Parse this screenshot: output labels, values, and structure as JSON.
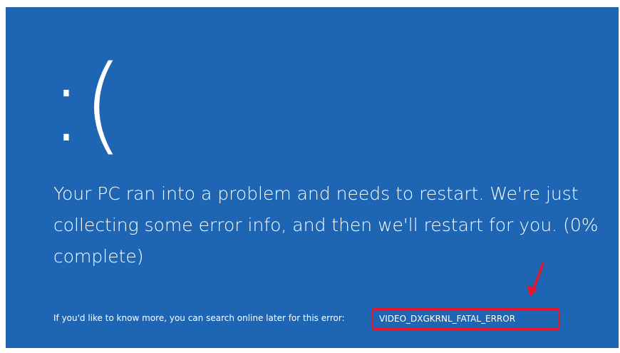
{
  "screen": {
    "background_color": "#1e66b4",
    "text_color": "#ffffff",
    "highlight_color": "#e5152b",
    "sad_face": ":(",
    "message": "Your PC ran into a problem and needs to restart. We're just collecting some error info, and then we'll restart for you. (0% complete)",
    "more_info_text": "If you'd like to know more, you can search online later for this error:",
    "stop_code": "VIDEO_DXGKRNL_FATAL_ERROR"
  },
  "annotation": {
    "icon": "red-arrow-icon",
    "highlight_box": "red-rounded-rectangle"
  }
}
